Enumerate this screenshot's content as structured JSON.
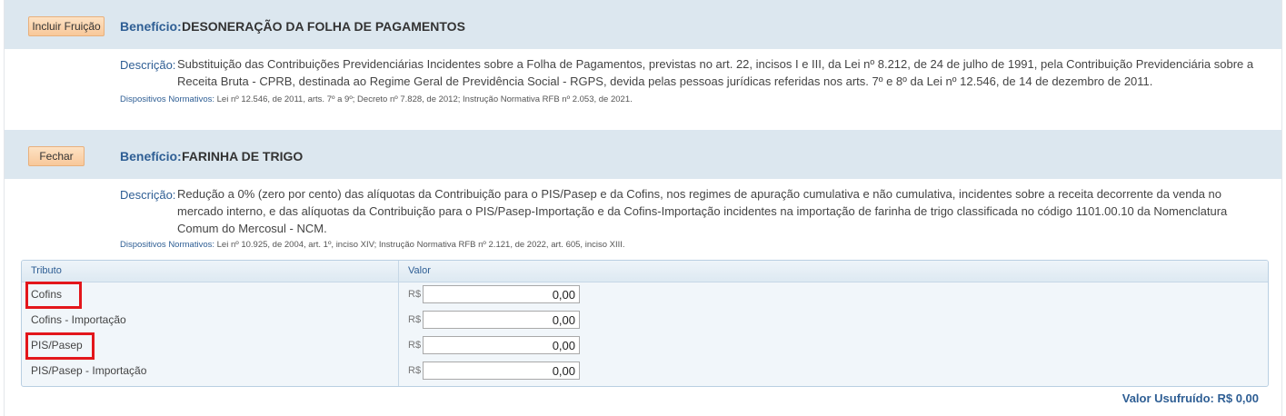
{
  "beneficios": [
    {
      "button_label": "Incluir Fruição",
      "label": "Benefício:",
      "name": "DESONERAÇÃO DA FOLHA DE PAGAMENTOS",
      "descricao_label": "Descrição:",
      "descricao_text": "Substituição das Contribuições Previdenciárias Incidentes sobre a Folha de Pagamentos, previstas no art. 22, incisos I e III, da Lei nº 8.212, de 24 de julho de 1991, pela Contribuição Previdenciária sobre a Receita Bruta - CPRB, destinada ao Regime Geral de Previdência Social - RGPS, devida pelas pessoas jurídicas referidas nos arts. 7º e 8º da Lei nº 12.546, de 14 de dezembro de 2011.",
      "dispositivos_label": "Dispositivos Normativos:",
      "dispositivos_text": "Lei nº 12.546, de 2011, arts. 7º a 9º; Decreto nº 7.828, de 2012; Instrução Normativa RFB nº 2.053, de 2021."
    },
    {
      "button_label": "Fechar",
      "label": "Benefício:",
      "name": "FARINHA DE TRIGO",
      "descricao_label": "Descrição:",
      "descricao_text": "Redução a 0% (zero por cento) das alíquotas da Contribuição para o PIS/Pasep e da Cofins, nos regimes de apuração cumulativa e não cumulativa, incidentes sobre a receita decorrente da venda no mercado interno, e das alíquotas da Contribuição para o PIS/Pasep-Importação e da Cofins-Importação incidentes na importação de farinha de trigo classificada no código 1101.00.10 da Nomenclatura Comum do Mercosul - NCM.",
      "dispositivos_label": "Dispositivos Normativos:",
      "dispositivos_text": "Lei nº 10.925, de 2004, art. 1º, inciso XIV; Instrução Normativa RFB nº 2.121, de 2022, art. 605, inciso XIII."
    }
  ],
  "table": {
    "headers": [
      "Tributo",
      "Valor"
    ],
    "rows": [
      {
        "tributo": "Cofins",
        "currency": "R$",
        "value": "0,00"
      },
      {
        "tributo": "Cofins - Importação",
        "currency": "R$",
        "value": "0,00"
      },
      {
        "tributo": "PIS/Pasep",
        "currency": "R$",
        "value": "0,00"
      },
      {
        "tributo": "PIS/Pasep - Importação",
        "currency": "R$",
        "value": "0,00"
      }
    ]
  },
  "total_label": "Valor Usufruído: R$ 0,00",
  "colors": {
    "highlight": "#e3161b",
    "accent": "#2e5e94",
    "band": "#dce7ef"
  }
}
